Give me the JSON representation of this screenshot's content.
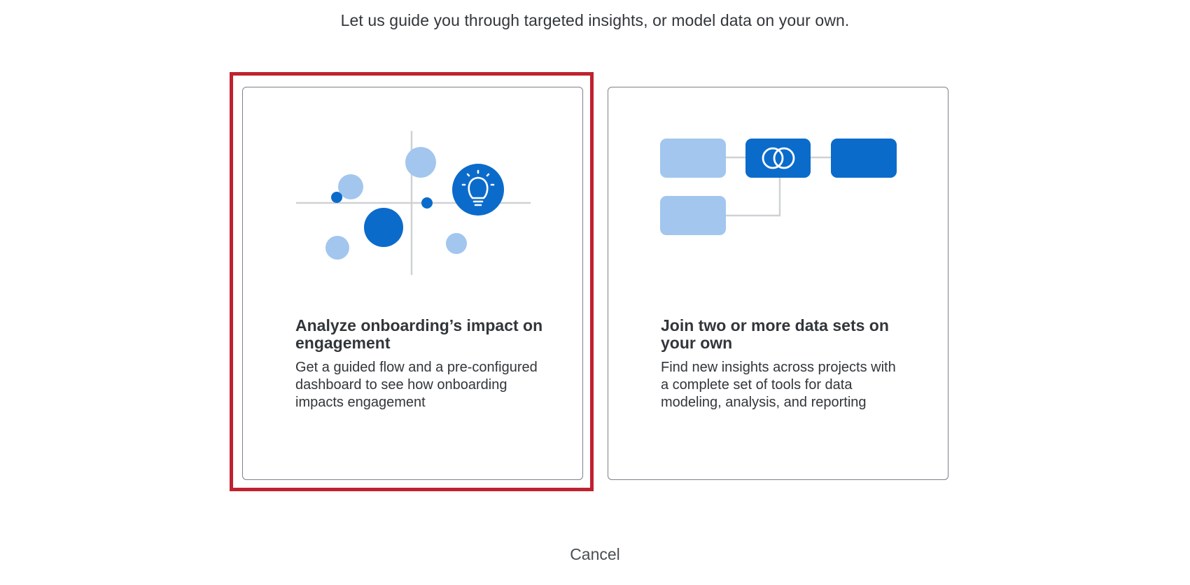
{
  "header": {
    "subtitle": "Let us guide you through targeted insights, or model data on your own."
  },
  "cards": [
    {
      "title": "Analyze onboarding’s impact on engagement",
      "description": "Get a guided flow and a pre-configured dashboard to see how onboarding impacts engagement",
      "illustration_icon": "scatter-insight-lightbulb-icon",
      "selected": true
    },
    {
      "title": "Join two or more data sets on your own",
      "description": "Find new insights across projects with a complete set of tools for data modeling, analysis, and reporting",
      "illustration_icon": "data-join-flow-icon",
      "selected": false
    }
  ],
  "footer": {
    "cancel_label": "Cancel"
  },
  "colors": {
    "selection_border": "#c0212f",
    "accent_blue": "#0b6bcb",
    "light_blue": "#a2c6ee",
    "line_gray": "#cfd1d3",
    "text": "#32363a"
  }
}
